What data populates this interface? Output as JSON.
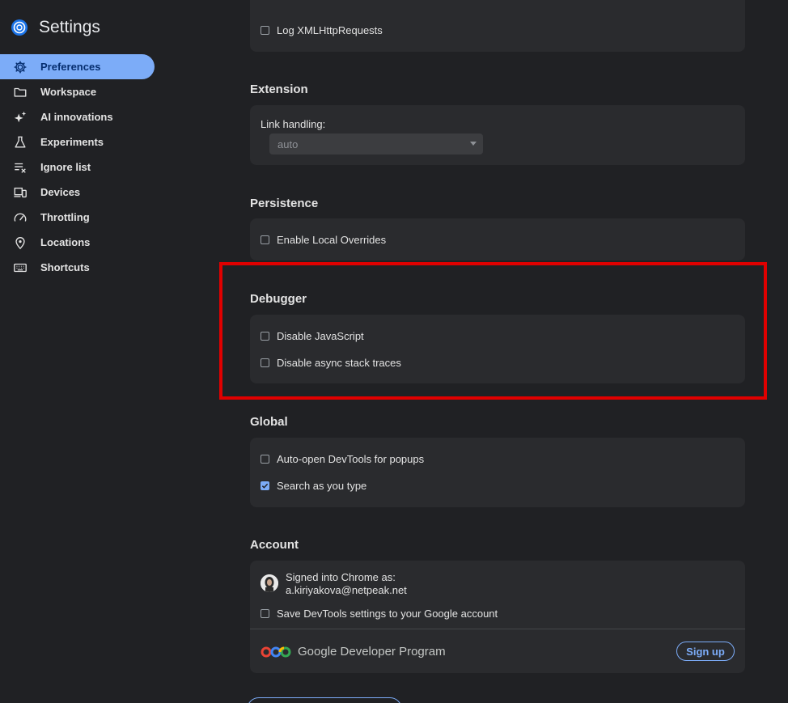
{
  "app": {
    "title": "Settings"
  },
  "sidebar": {
    "items": [
      {
        "label": "Preferences",
        "icon": "gear-icon",
        "active": true
      },
      {
        "label": "Workspace",
        "icon": "folder-icon"
      },
      {
        "label": "AI innovations",
        "icon": "sparkle-icon"
      },
      {
        "label": "Experiments",
        "icon": "flask-icon"
      },
      {
        "label": "Ignore list",
        "icon": "list-remove-icon"
      },
      {
        "label": "Devices",
        "icon": "devices-icon"
      },
      {
        "label": "Throttling",
        "icon": "speedometer-icon"
      },
      {
        "label": "Locations",
        "icon": "location-pin-icon"
      },
      {
        "label": "Shortcuts",
        "icon": "keyboard-icon"
      }
    ]
  },
  "sections": {
    "network_tail": {
      "log_xhr_label": "Log XMLHttpRequests"
    },
    "extension": {
      "title": "Extension",
      "link_handling_label": "Link handling:",
      "link_handling_value": "auto"
    },
    "persistence": {
      "title": "Persistence",
      "enable_local_overrides": "Enable Local Overrides"
    },
    "debugger": {
      "title": "Debugger",
      "disable_javascript": "Disable JavaScript",
      "disable_async_stack_traces": "Disable async stack traces"
    },
    "global": {
      "title": "Global",
      "auto_open_devtools": "Auto-open DevTools for popups",
      "search_as_you_type": "Search as you type"
    },
    "account": {
      "title": "Account",
      "signed_in_label": "Signed into Chrome as:",
      "email": "a.kiriyakova@netpeak.net",
      "save_settings_label": "Save DevTools settings to your Google account",
      "program_name": "Google Developer Program",
      "signup_label": "Sign up"
    }
  },
  "colors": {
    "background": "#202124",
    "card": "#2a2b2e",
    "accent": "#7cacf8",
    "highlight": "#e00000"
  }
}
